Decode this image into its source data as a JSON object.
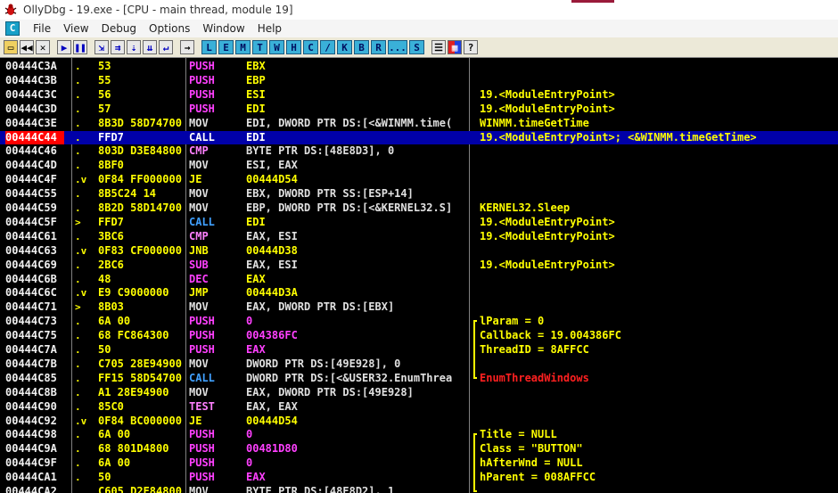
{
  "window": {
    "title": "OllyDbg - 19.exe - [CPU - main thread, module 19]"
  },
  "menu": [
    "File",
    "View",
    "Debug",
    "Options",
    "Window",
    "Help"
  ],
  "toolbar": {
    "letters": [
      "L",
      "E",
      "M",
      "T",
      "W",
      "H",
      "C",
      "/",
      "K",
      "B",
      "R",
      "...",
      "S"
    ]
  },
  "colors": {
    "push": "#ff00ff",
    "call": "#0aa0ff",
    "jump": "#ffff00",
    "cmp": "#ff8cff",
    "mov": "#e0e0e0",
    "arith": "#e0e0e0",
    "operand": "#e0e0e0",
    "imm": "#ffff00",
    "comment": "#ffff00",
    "api": "#ff3030"
  },
  "rows": [
    {
      "addr": "00444C3A",
      "mark": ".",
      "hex": "53",
      "mn": "PUSH",
      "mncolor": "#ff40ff",
      "op": "EBX",
      "opcolor": "#ffff00",
      "cmt": ""
    },
    {
      "addr": "00444C3B",
      "mark": ".",
      "hex": "55",
      "mn": "PUSH",
      "mncolor": "#ff40ff",
      "op": "EBP",
      "opcolor": "#ffff00",
      "cmt": ""
    },
    {
      "addr": "00444C3C",
      "mark": ".",
      "hex": "56",
      "mn": "PUSH",
      "mncolor": "#ff40ff",
      "op": "ESI",
      "opcolor": "#ffff00",
      "cmt": "19.<ModuleEntryPoint>"
    },
    {
      "addr": "00444C3D",
      "mark": ".",
      "hex": "57",
      "mn": "PUSH",
      "mncolor": "#ff40ff",
      "op": "EDI",
      "opcolor": "#ffff00",
      "cmt": "19.<ModuleEntryPoint>"
    },
    {
      "addr": "00444C3E",
      "mark": ".",
      "hex": "8B3D 58D74700",
      "mn": "MOV",
      "mncolor": "#e0e0e0",
      "op": "EDI, DWORD PTR DS:[<&WINMM.time(",
      "opcolor": "#e0e0e0",
      "cmt": "WINMM.timeGetTime"
    },
    {
      "addr": "00444C44",
      "mark": ".",
      "hex": "FFD7",
      "mn": "CALL",
      "mncolor": "#40a0ff",
      "op": "EDI",
      "opcolor": "#ffffff",
      "cmt": "19.<ModuleEntryPoint>; <&WINMM.timeGetTime>",
      "sel": true,
      "cur": true
    },
    {
      "addr": "00444C46",
      "mark": ".",
      "hex": "803D D3E84800",
      "mn": "CMP",
      "mncolor": "#ff80ff",
      "op": "BYTE PTR DS:[48E8D3], 0",
      "opcolor": "#e0e0e0",
      "cmt": ""
    },
    {
      "addr": "00444C4D",
      "mark": ".",
      "hex": "8BF0",
      "mn": "MOV",
      "mncolor": "#e0e0e0",
      "op": "ESI, EAX",
      "opcolor": "#e0e0e0",
      "cmt": ""
    },
    {
      "addr": "00444C4F",
      "mark": ".v",
      "hex": "0F84 FF000000",
      "mn": "JE",
      "mncolor": "#ffff00",
      "op": "00444D54",
      "opcolor": "#ffff00",
      "cmt": ""
    },
    {
      "addr": "00444C55",
      "mark": ".",
      "hex": "8B5C24 14",
      "mn": "MOV",
      "mncolor": "#e0e0e0",
      "op": "EBX, DWORD PTR SS:[ESP+14]",
      "opcolor": "#e0e0e0",
      "cmt": ""
    },
    {
      "addr": "00444C59",
      "mark": ".",
      "hex": "8B2D 58D14700",
      "mn": "MOV",
      "mncolor": "#e0e0e0",
      "op": "EBP, DWORD PTR DS:[<&KERNEL32.S]",
      "opcolor": "#e0e0e0",
      "cmt": "KERNEL32.Sleep"
    },
    {
      "addr": "00444C5F",
      "mark": ">",
      "hex": "FFD7",
      "mn": "CALL",
      "mncolor": "#40a0ff",
      "op": "EDI",
      "opcolor": "#ffff00",
      "cmt": "19.<ModuleEntryPoint>"
    },
    {
      "addr": "00444C61",
      "mark": ".",
      "hex": "3BC6",
      "mn": "CMP",
      "mncolor": "#ff80ff",
      "op": "EAX, ESI",
      "opcolor": "#e0e0e0",
      "cmt": "19.<ModuleEntryPoint>"
    },
    {
      "addr": "00444C63",
      "mark": ".v",
      "hex": "0F83 CF000000",
      "mn": "JNB",
      "mncolor": "#ffff00",
      "op": "00444D38",
      "opcolor": "#ffff00",
      "cmt": ""
    },
    {
      "addr": "00444C69",
      "mark": ".",
      "hex": "2BC6",
      "mn": "SUB",
      "mncolor": "#ff40ff",
      "op": "EAX, ESI",
      "opcolor": "#e0e0e0",
      "cmt": "19.<ModuleEntryPoint>"
    },
    {
      "addr": "00444C6B",
      "mark": ".",
      "hex": "48",
      "mn": "DEC",
      "mncolor": "#ff40ff",
      "op": "EAX",
      "opcolor": "#ffff00",
      "cmt": ""
    },
    {
      "addr": "00444C6C",
      "mark": ".v",
      "hex": "E9 C9000000",
      "mn": "JMP",
      "mncolor": "#ffff00",
      "op": "00444D3A",
      "opcolor": "#ffff00",
      "cmt": ""
    },
    {
      "addr": "00444C71",
      "mark": ">",
      "hex": "8B03",
      "mn": "MOV",
      "mncolor": "#e0e0e0",
      "op": "EAX, DWORD PTR DS:[EBX]",
      "opcolor": "#e0e0e0",
      "cmt": ""
    },
    {
      "addr": "00444C73",
      "mark": ".",
      "hex": "6A 00",
      "mn": "PUSH",
      "mncolor": "#ff40ff",
      "op": "0",
      "opcolor": "#ff40ff",
      "cmt": "lParam = 0"
    },
    {
      "addr": "00444C75",
      "mark": ".",
      "hex": "68 FC864300",
      "mn": "PUSH",
      "mncolor": "#ff40ff",
      "op": "004386FC",
      "opcolor": "#ff40ff",
      "cmt": "Callback = 19.004386FC"
    },
    {
      "addr": "00444C7A",
      "mark": ".",
      "hex": "50",
      "mn": "PUSH",
      "mncolor": "#ff40ff",
      "op": "EAX",
      "opcolor": "#ff40ff",
      "cmt": "ThreadID = 8AFFCC"
    },
    {
      "addr": "00444C7B",
      "mark": ".",
      "hex": "C705 28E94900",
      "mn": "MOV",
      "mncolor": "#e0e0e0",
      "op": "DWORD PTR DS:[49E928], 0",
      "opcolor": "#e0e0e0",
      "cmt": ""
    },
    {
      "addr": "00444C85",
      "mark": ".",
      "hex": "FF15 58D54700",
      "mn": "CALL",
      "mncolor": "#40a0ff",
      "op": "DWORD PTR DS:[<&USER32.EnumThrea",
      "opcolor": "#e0e0e0",
      "cmt": "EnumThreadWindows",
      "cmtcolor": "#ff2020"
    },
    {
      "addr": "00444C8B",
      "mark": ".",
      "hex": "A1 28E94900",
      "mn": "MOV",
      "mncolor": "#e0e0e0",
      "op": "EAX, DWORD PTR DS:[49E928]",
      "opcolor": "#e0e0e0",
      "cmt": ""
    },
    {
      "addr": "00444C90",
      "mark": ".",
      "hex": "85C0",
      "mn": "TEST",
      "mncolor": "#ff80ff",
      "op": "EAX, EAX",
      "opcolor": "#e0e0e0",
      "cmt": ""
    },
    {
      "addr": "00444C92",
      "mark": ".v",
      "hex": "0F84 BC000000",
      "mn": "JE",
      "mncolor": "#ffff00",
      "op": "00444D54",
      "opcolor": "#ffff00",
      "cmt": ""
    },
    {
      "addr": "00444C98",
      "mark": ".",
      "hex": "6A 00",
      "mn": "PUSH",
      "mncolor": "#ff40ff",
      "op": "0",
      "opcolor": "#ff40ff",
      "cmt": "Title = NULL"
    },
    {
      "addr": "00444C9A",
      "mark": ".",
      "hex": "68 801D4800",
      "mn": "PUSH",
      "mncolor": "#ff40ff",
      "op": "00481D80",
      "opcolor": "#ff40ff",
      "cmt": "Class = \"BUTTON\""
    },
    {
      "addr": "00444C9F",
      "mark": ".",
      "hex": "6A 00",
      "mn": "PUSH",
      "mncolor": "#ff40ff",
      "op": "0",
      "opcolor": "#ff40ff",
      "cmt": "hAfterWnd = NULL"
    },
    {
      "addr": "00444CA1",
      "mark": ".",
      "hex": "50",
      "mn": "PUSH",
      "mncolor": "#ff40ff",
      "op": "EAX",
      "opcolor": "#ff40ff",
      "cmt": "hParent = 008AFFCC"
    },
    {
      "addr": "00444CA2",
      "mark": ".",
      "hex": "C605 D2E84800",
      "mn": "MOV",
      "mncolor": "#e0e0e0",
      "op": "BYTE PTR DS:[48E8D2], 1",
      "opcolor": "#e0e0e0",
      "cmt": ""
    }
  ]
}
